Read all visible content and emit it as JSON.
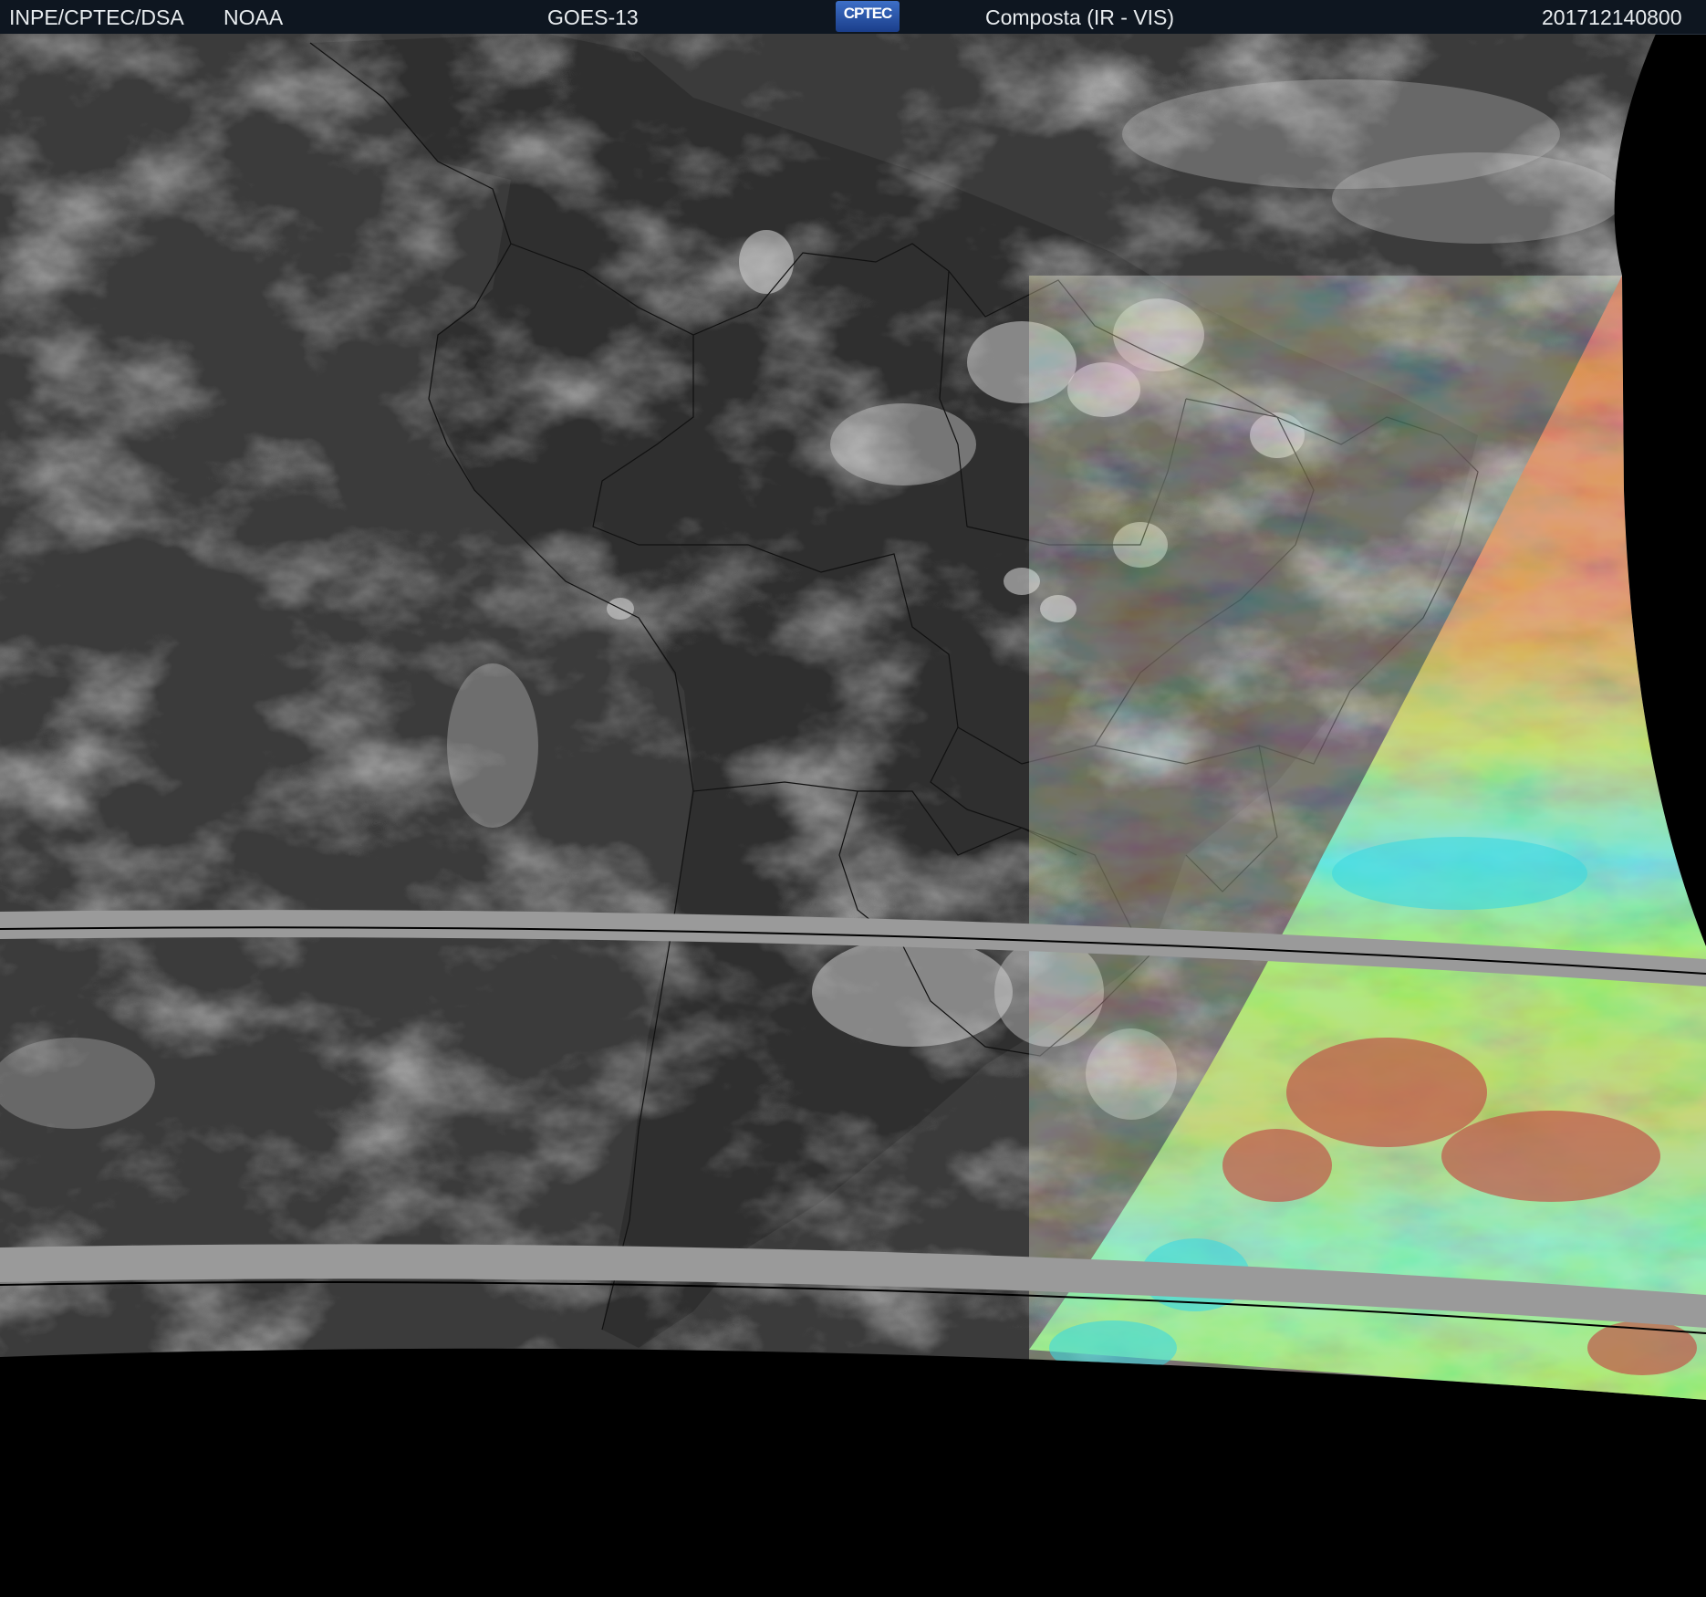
{
  "header": {
    "org": "INPE/CPTEC/DSA",
    "agency": "NOAA",
    "satellite": "GOES-13",
    "logo_text": "CPTEC",
    "product": "Composta (IR - VIS)",
    "timestamp": "201712140800"
  },
  "colors": {
    "header_bg": "#0e1620",
    "space": "#000000",
    "ocean_ir": "#3a3a3a",
    "cloud": "#c8c8c8",
    "missing_band": "#9a9a9a",
    "vis_red": "#c0564a",
    "vis_green": "#8fe04a",
    "vis_cyan": "#3ed8e0"
  }
}
